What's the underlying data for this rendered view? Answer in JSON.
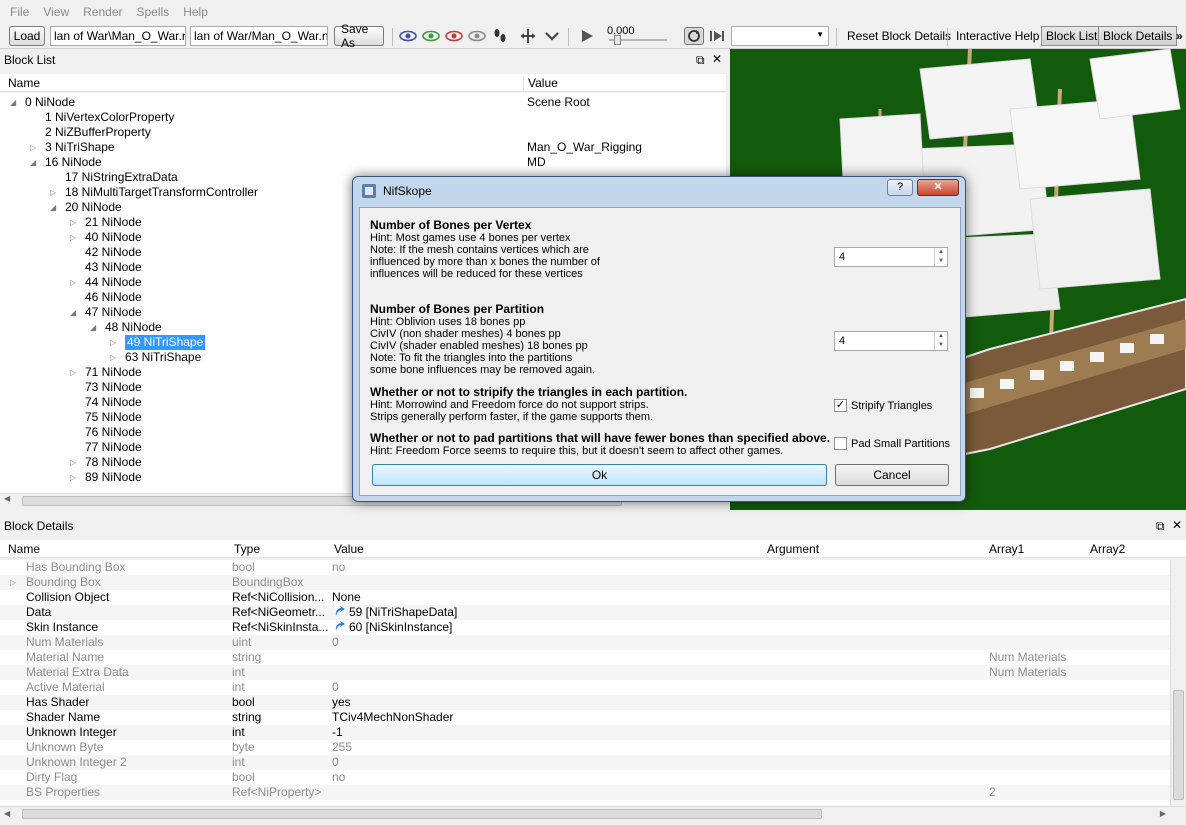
{
  "menu": [
    "File",
    "View",
    "Render",
    "Spells",
    "Help"
  ],
  "toolbar": {
    "load_label": "Load",
    "load_path": "lan of War\\Man_O_War.nif",
    "save_path": "lan of War/Man_O_War.nif",
    "save_as_label": "Save As",
    "time_value": "0.000",
    "reset_label": "Reset Block Details",
    "help_label": "Interactive Help",
    "block_list_label": "Block List",
    "block_details_label": "Block Details",
    "overflow": "»"
  },
  "block_list": {
    "title": "Block List",
    "col_name": "Name",
    "col_value": "Value",
    "rows": [
      {
        "name": "0 NiNode",
        "value": "Scene Root",
        "level": 0,
        "arrow": "open"
      },
      {
        "name": "1 NiVertexColorProperty",
        "value": "",
        "level": 1,
        "arrow": "none"
      },
      {
        "name": "2 NiZBufferProperty",
        "value": "",
        "level": 1,
        "arrow": "none"
      },
      {
        "name": "3 NiTriShape",
        "value": "Man_O_War_Rigging",
        "level": 1,
        "arrow": "closed"
      },
      {
        "name": "16 NiNode",
        "value": "MD",
        "level": 1,
        "arrow": "open"
      },
      {
        "name": "17 NiStringExtraData",
        "value": "",
        "level": 2,
        "arrow": "none"
      },
      {
        "name": "18 NiMultiTargetTransformController",
        "value": "",
        "level": 2,
        "arrow": "closed"
      },
      {
        "name": "20 NiNode",
        "value": "",
        "level": 2,
        "arrow": "open"
      },
      {
        "name": "21 NiNode",
        "value": "",
        "level": 3,
        "arrow": "closed"
      },
      {
        "name": "40 NiNode",
        "value": "",
        "level": 3,
        "arrow": "closed"
      },
      {
        "name": "42 NiNode",
        "value": "",
        "level": 3,
        "arrow": "none"
      },
      {
        "name": "43 NiNode",
        "value": "",
        "level": 3,
        "arrow": "none"
      },
      {
        "name": "44 NiNode",
        "value": "",
        "level": 3,
        "arrow": "closed"
      },
      {
        "name": "46 NiNode",
        "value": "",
        "level": 3,
        "arrow": "none"
      },
      {
        "name": "47 NiNode",
        "value": "",
        "level": 3,
        "arrow": "open"
      },
      {
        "name": "48 NiNode",
        "value": "",
        "level": 4,
        "arrow": "open"
      },
      {
        "name": "49 NiTriShape",
        "value": "",
        "level": 5,
        "arrow": "closed",
        "selected": true
      },
      {
        "name": "63 NiTriShape",
        "value": "",
        "level": 5,
        "arrow": "closed"
      },
      {
        "name": "71 NiNode",
        "value": "",
        "level": 3,
        "arrow": "closed"
      },
      {
        "name": "73 NiNode",
        "value": "",
        "level": 3,
        "arrow": "none"
      },
      {
        "name": "74 NiNode",
        "value": "",
        "level": 3,
        "arrow": "none"
      },
      {
        "name": "75 NiNode",
        "value": "",
        "level": 3,
        "arrow": "none"
      },
      {
        "name": "76 NiNode",
        "value": "",
        "level": 3,
        "arrow": "none"
      },
      {
        "name": "77 NiNode",
        "value": "",
        "level": 3,
        "arrow": "none"
      },
      {
        "name": "78 NiNode",
        "value": "",
        "level": 3,
        "arrow": "closed"
      },
      {
        "name": "89 NiNode",
        "value": "",
        "level": 3,
        "arrow": "closed"
      }
    ]
  },
  "block_details": {
    "title": "Block Details",
    "columns": [
      "Name",
      "Type",
      "Value",
      "Argument",
      "Array1",
      "Array2"
    ],
    "rows": [
      {
        "name": "Has Bounding Box",
        "type": "bool",
        "value": "no",
        "array1": "",
        "active": false,
        "arrow": false
      },
      {
        "name": "Bounding Box",
        "type": "BoundingBox",
        "value": "",
        "array1": "",
        "active": false,
        "arrow": true
      },
      {
        "name": "Collision Object",
        "type": "Ref<NiCollision...",
        "value": "None",
        "array1": "",
        "active": true,
        "arrow": false
      },
      {
        "name": "Data",
        "type": "Ref<NiGeometr...",
        "value": "59 [NiTriShapeData]",
        "array1": "",
        "active": true,
        "arrow": false,
        "link": true
      },
      {
        "name": "Skin Instance",
        "type": "Ref<NiSkinInsta...",
        "value": "60 [NiSkinInstance]",
        "array1": "",
        "active": true,
        "arrow": false,
        "link": true
      },
      {
        "name": "Num Materials",
        "type": "uint",
        "value": "0",
        "array1": "",
        "active": false,
        "arrow": false
      },
      {
        "name": "Material Name",
        "type": "string",
        "value": "",
        "array1": "Num Materials",
        "active": false,
        "arrow": false
      },
      {
        "name": "Material Extra Data",
        "type": "int",
        "value": "",
        "array1": "Num Materials",
        "active": false,
        "arrow": false
      },
      {
        "name": "Active Material",
        "type": "int",
        "value": "0",
        "array1": "",
        "active": false,
        "arrow": false
      },
      {
        "name": "Has Shader",
        "type": "bool",
        "value": "yes",
        "array1": "",
        "active": true,
        "arrow": false
      },
      {
        "name": "Shader Name",
        "type": "string",
        "value": "TCiv4MechNonShader",
        "array1": "",
        "active": true,
        "arrow": false
      },
      {
        "name": "Unknown Integer",
        "type": "int",
        "value": "-1",
        "array1": "",
        "active": true,
        "arrow": false
      },
      {
        "name": "Unknown Byte",
        "type": "byte",
        "value": "255",
        "array1": "",
        "active": false,
        "arrow": false
      },
      {
        "name": "Unknown Integer 2",
        "type": "int",
        "value": "0",
        "array1": "",
        "active": false,
        "arrow": false
      },
      {
        "name": "Dirty Flag",
        "type": "bool",
        "value": "no",
        "array1": "",
        "active": false,
        "arrow": false
      },
      {
        "name": "BS Properties",
        "type": "Ref<NiProperty>",
        "value": "",
        "array1": "2",
        "active": false,
        "arrow": false
      }
    ]
  },
  "dialog": {
    "title": "NifSkope",
    "help_btn": "?",
    "close_btn": "✕",
    "bones_vertex": {
      "heading": "Number of Bones per Vertex",
      "lines": [
        "Hint: Most games use 4 bones per vertex",
        "Note: If the mesh contains vertices which are",
        "influenced by more than x bones the number of",
        "influences will be reduced for these vertices"
      ],
      "value": "4"
    },
    "bones_partition": {
      "heading": "Number of Bones per Partition",
      "lines": [
        "Hint: Oblivion uses 18 bones pp",
        "CivIV (non shader meshes) 4 bones pp",
        "CivIV (shader enabled meshes) 18 bones pp",
        "Note: To fit the triangles into the partitions",
        "some bone influences may be removed again."
      ],
      "value": "4"
    },
    "stripify": {
      "heading": "Whether or not to stripify the triangles in each partition.",
      "lines": [
        "Hint: Morrowind and Freedom force do not support strips.",
        "Strips generally perform faster, if the game supports them."
      ],
      "checkbox_label": "Stripify Triangles",
      "checked": true
    },
    "pad": {
      "heading": "Whether or not to pad partitions that will have fewer bones than specified above.",
      "lines": [
        "Hint: Freedom Force seems to require this, but it doesn't seem to affect other games."
      ],
      "checkbox_label": "Pad Small Partitions",
      "checked": false
    },
    "ok_label": "Ok",
    "cancel_label": "Cancel"
  },
  "icons": {
    "eye_colors": [
      "#3c52a8",
      "#3a9a3a",
      "#c43b3b",
      "#8a8a8a"
    ],
    "viewport_bg": "#135b0c",
    "selection": "#3399ff"
  }
}
